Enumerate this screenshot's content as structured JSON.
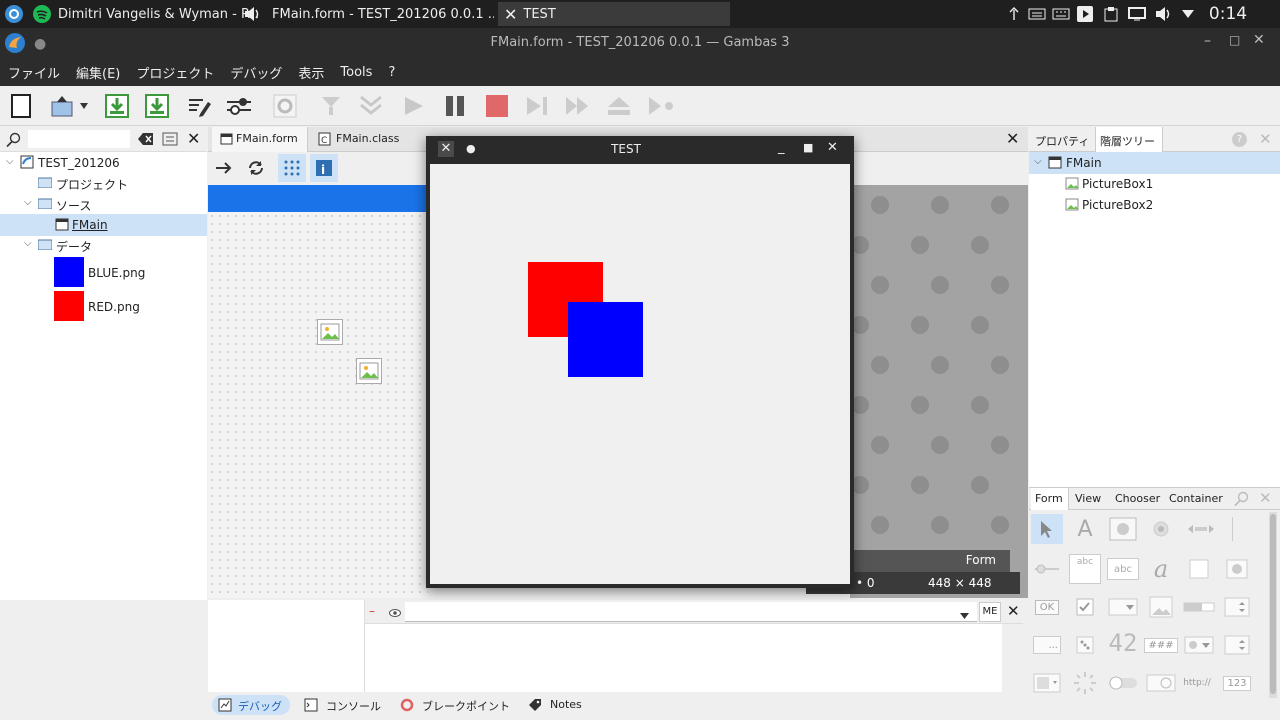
{
  "taskbar": {
    "tasks": [
      {
        "label": "Dimitri Vangelis & Wyman - P..."
      },
      {
        "label": "FMain.form - TEST_201206 0.0.1 ..."
      },
      {
        "label": "TEST"
      }
    ],
    "clock": "0:14"
  },
  "window": {
    "title": "FMain.form - TEST_201206 0.0.1 — Gambas 3"
  },
  "menu": {
    "items": [
      "ファイル",
      "編集(E)",
      "プロジェクト",
      "デバッグ",
      "表示",
      "Tools",
      "?"
    ]
  },
  "project_tree": {
    "root": "TEST_201206",
    "items": [
      {
        "label": "プロジェクト"
      },
      {
        "label": "ソース"
      },
      {
        "label": "FMain"
      },
      {
        "label": "データ"
      },
      {
        "label": "BLUE.png"
      },
      {
        "label": "RED.png"
      }
    ]
  },
  "editor": {
    "tabs": [
      {
        "label": "FMain.form"
      },
      {
        "label": "FMain.class"
      }
    ],
    "status": {
      "type": "Form",
      "position": "• 0",
      "size": "448 × 448"
    }
  },
  "test_window": {
    "title": "TEST"
  },
  "right_panel": {
    "tabs": [
      {
        "label": "プロパティ"
      },
      {
        "label": "階層ツリー"
      }
    ],
    "tree": [
      {
        "label": "FMain"
      },
      {
        "label": "PictureBox1"
      },
      {
        "label": "PictureBox2"
      }
    ]
  },
  "toolbox": {
    "tabs": [
      {
        "label": "Form"
      },
      {
        "label": "View"
      },
      {
        "label": "Chooser"
      },
      {
        "label": "Container"
      }
    ],
    "labels": {
      "abc1": "abc",
      "abc2": "abc",
      "italic": "a",
      "ok": "OK",
      "dots": "...",
      "digits": "42",
      "hash": "###",
      "url": "http://",
      "num": "123"
    }
  },
  "console": {
    "me_label": "ME"
  },
  "bottom_tabs": [
    {
      "label": "デバッグ"
    },
    {
      "label": "コンソール"
    },
    {
      "label": "ブレークポイント"
    },
    {
      "label": "Notes"
    }
  ],
  "colors": {
    "accent": "#1a73e8",
    "red": "#ff0000",
    "blue": "#0000ff",
    "taskbar": "#1f1f1f",
    "titlebar": "#2c2c2c"
  }
}
